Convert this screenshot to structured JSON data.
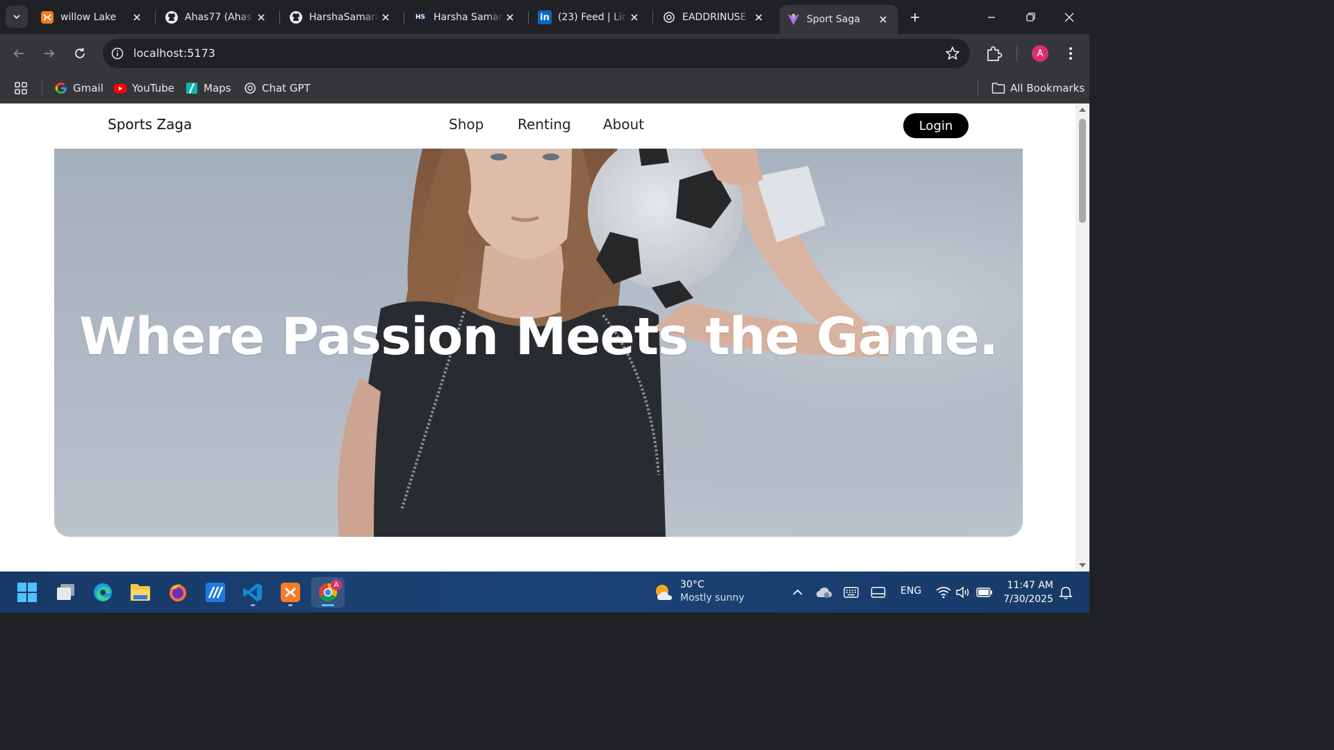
{
  "browser": {
    "tabs": [
      {
        "title": "willow Lake",
        "icon": "xampp-icon"
      },
      {
        "title": "Ahas77 (Ahas",
        "icon": "github-icon"
      },
      {
        "title": "HarshaSamara",
        "icon": "github-icon"
      },
      {
        "title": "Harsha Saman",
        "icon": "hs-icon",
        "icon_text": "HS"
      },
      {
        "title": "(23) Feed | Lin",
        "icon": "linkedin-icon",
        "icon_text": "in"
      },
      {
        "title": "EADDRINUSE",
        "icon": "chatgpt-icon"
      },
      {
        "title": "Sport Saga",
        "icon": "vite-icon",
        "active": true
      }
    ],
    "url": "localhost:5173",
    "profile_initial": "A",
    "bookmarks": [
      {
        "label": "Gmail",
        "icon": "google-icon"
      },
      {
        "label": "YouTube",
        "icon": "youtube-icon"
      },
      {
        "label": "Maps",
        "icon": "maps-icon"
      },
      {
        "label": "Chat GPT",
        "icon": "chatgpt-icon"
      }
    ],
    "all_bookmarks": "All Bookmarks"
  },
  "site": {
    "brand": "Sports Zaga",
    "nav": [
      "Shop",
      "Renting",
      "About"
    ],
    "login": "Login",
    "hero_heading": "Where Passion Meets the Game."
  },
  "taskbar": {
    "weather_temp": "30°C",
    "weather_condition": "Mostly sunny",
    "language": "ENG",
    "time": "11:47 AM",
    "date": "7/30/2025",
    "chrome_badge": "A"
  },
  "colors": {
    "browser_dark": "#202124",
    "toolbar": "#35363a",
    "login_bg": "#000000",
    "taskbar": "#1b4276"
  }
}
